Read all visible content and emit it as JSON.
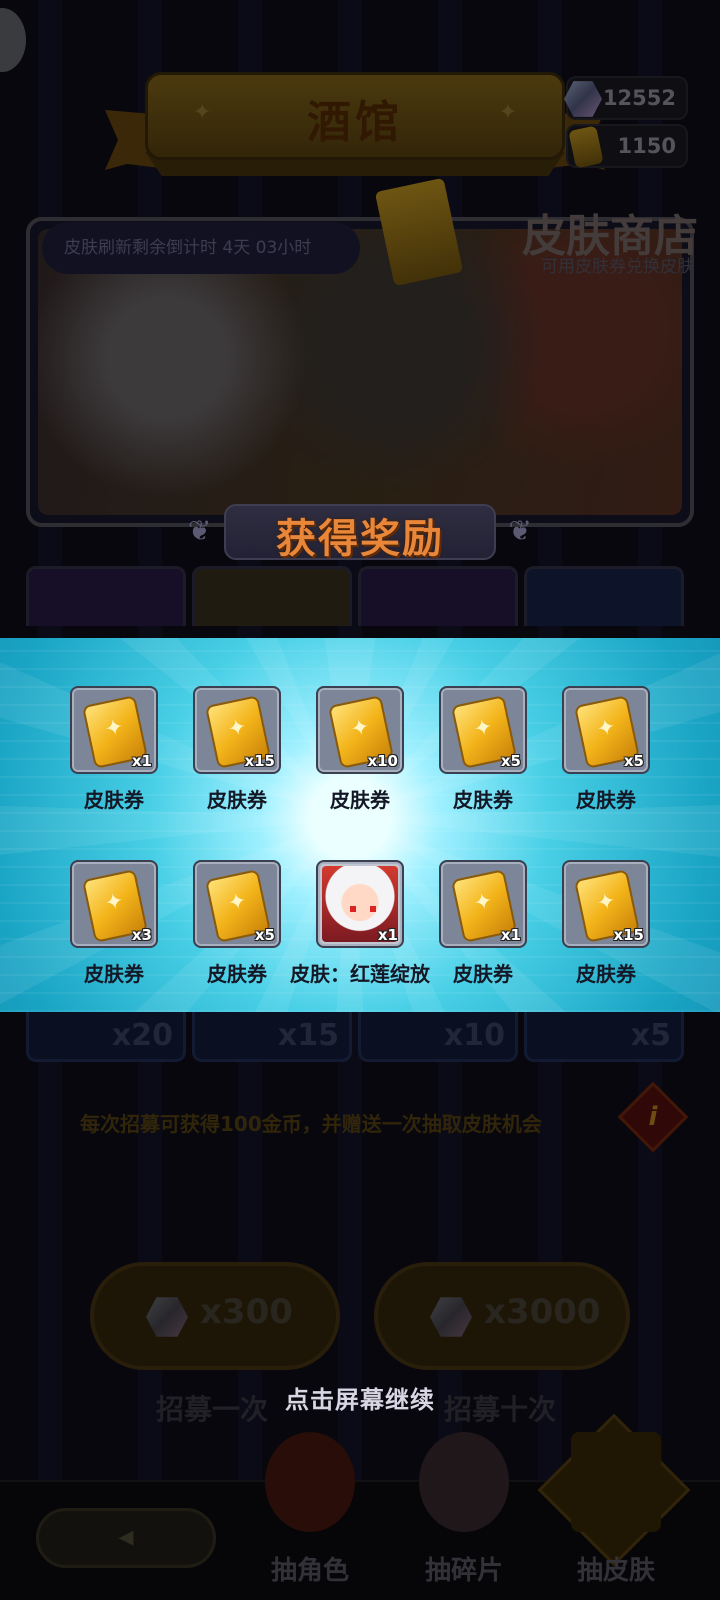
{
  "header": {
    "title": "酒馆",
    "currency": [
      {
        "icon": "gem-icon",
        "value": "12552"
      },
      {
        "icon": "skin-ticket-icon",
        "value": "1150"
      }
    ]
  },
  "shop_banner": {
    "countdown": "皮肤刷新剩余倒计时  4天 03小时",
    "title": "皮肤商店",
    "subtitle": "可用皮肤券兑换皮肤"
  },
  "reward_popup": {
    "title": "获得奖励",
    "items": [
      {
        "type": "ticket",
        "name": "皮肤券",
        "qty": "x1"
      },
      {
        "type": "ticket",
        "name": "皮肤券",
        "qty": "x15"
      },
      {
        "type": "ticket",
        "name": "皮肤券",
        "qty": "x10"
      },
      {
        "type": "ticket",
        "name": "皮肤券",
        "qty": "x5"
      },
      {
        "type": "ticket",
        "name": "皮肤券",
        "qty": "x5"
      },
      {
        "type": "ticket",
        "name": "皮肤券",
        "qty": "x3"
      },
      {
        "type": "ticket",
        "name": "皮肤券",
        "qty": "x5"
      },
      {
        "type": "skin",
        "name": "皮肤：红莲绽放",
        "qty": "x1"
      },
      {
        "type": "ticket",
        "name": "皮肤券",
        "qty": "x1"
      },
      {
        "type": "ticket",
        "name": "皮肤券",
        "qty": "x15"
      }
    ],
    "continue_hint": "点击屏幕继续"
  },
  "prize_pool_qty": [
    "x20",
    "x15",
    "x10",
    "x5"
  ],
  "info_text": "每次招募可获得100金币，并赠送一次抽取皮肤机会",
  "recruit": {
    "single": {
      "cost": "x300",
      "label": "招募一次"
    },
    "ten": {
      "cost": "x3000",
      "label": "招募十次"
    }
  },
  "nav": {
    "items": [
      {
        "label": "抽角色"
      },
      {
        "label": "抽碎片"
      },
      {
        "label": "抽皮肤"
      }
    ]
  },
  "colors": {
    "accent_orange": "#e8863a",
    "panel_cyan": "#48cfe6",
    "ticket_gold": "#f3b41a"
  }
}
